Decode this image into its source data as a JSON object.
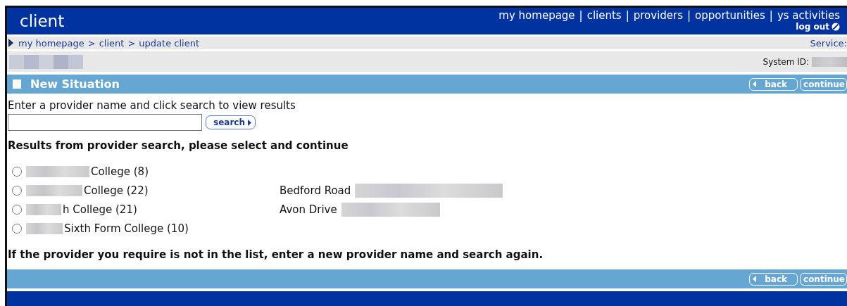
{
  "header": {
    "title": "client",
    "nav": [
      "my homepage",
      "clients",
      "providers",
      "opportunities",
      "ys activities"
    ],
    "nav_separators": [
      "|",
      "|",
      "|",
      "|"
    ],
    "logout": "log out"
  },
  "breadcrumb": [
    "my homepage",
    "client",
    "update client"
  ],
  "breadcrumb_separators": [
    ">",
    ">"
  ],
  "service_label": "Service:",
  "system_id_label": "System ID:",
  "section": {
    "title": "New Situation",
    "buttons": [
      "back",
      "continue"
    ]
  },
  "instruction": "Enter a provider name and click search to view results",
  "search": {
    "button": "search"
  },
  "results_heading": "Results from provider search, please select and continue",
  "results": [
    {
      "name": "College (8)",
      "selected": false
    },
    {
      "name": "College (22)",
      "address": "Bedford Road",
      "selected": false
    },
    {
      "name": "h College (21)",
      "address": "Avon Drive",
      "selected": false
    },
    {
      "name": "Sixth Form College (10)",
      "selected": false
    }
  ],
  "footer_note": "If the provider you require is not in the list, enter a new provider name and search again.",
  "footer_buttons": [
    "back",
    "continue"
  ]
}
